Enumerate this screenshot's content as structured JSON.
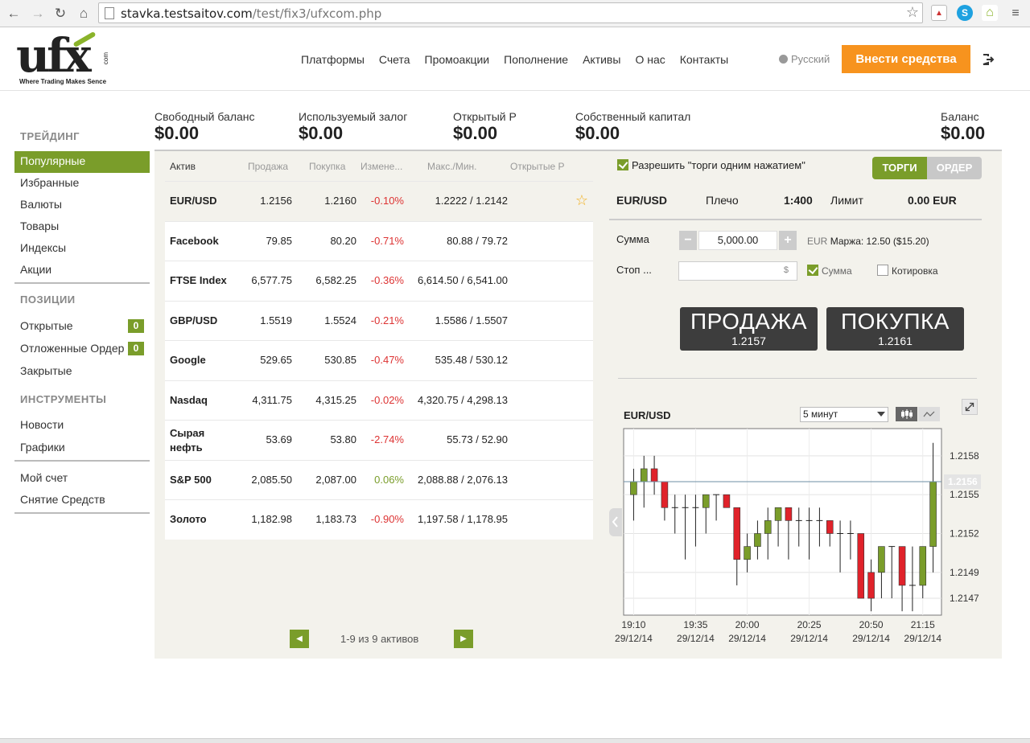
{
  "browser": {
    "url_host": "stavka.testsaitov.com",
    "url_path": "/test/fix3/ufxcom.php"
  },
  "logo": {
    "text": "ufx",
    "com": "com",
    "tagline": "Where Trading Makes Sence"
  },
  "nav": {
    "items": [
      "Платформы",
      "Счета",
      "Промоакции",
      "Пополнение",
      "Активы",
      "О нас",
      "Контакты"
    ],
    "language": "Русский",
    "deposit_button": "Внести средства"
  },
  "sidebar": {
    "trading_heading": "ТРЕЙДИНГ",
    "trading_items": [
      "Популярные",
      "Избранные",
      "Валюты",
      "Товары",
      "Индексы",
      "Акции"
    ],
    "positions_heading": "ПОЗИЦИИ",
    "positions_items": [
      {
        "label": "Открытые",
        "badge": "0"
      },
      {
        "label": "Отложенные Ордер",
        "badge": "0"
      },
      {
        "label": "Закрытые",
        "badge": ""
      }
    ],
    "tools_heading": "ИНСТРУМЕНТЫ",
    "tools_items": [
      "Новости",
      "Графики"
    ],
    "account_items": [
      "Мой счет",
      "Снятие Средств"
    ]
  },
  "balances": [
    {
      "label": "Свободный баланс",
      "value": "$0.00"
    },
    {
      "label": "Используемый залог",
      "value": "$0.00"
    },
    {
      "label": "Открытый P",
      "value": "$0.00"
    },
    {
      "label": "Собственный капитал",
      "value": "$0.00"
    },
    {
      "label": "Баланс",
      "value": "$0.00"
    }
  ],
  "table": {
    "headers": [
      "Актив",
      "Продажа",
      "Покупка",
      "Измене...",
      "Макс./Мин.",
      "Открытые Р"
    ],
    "rows": [
      {
        "name": "EUR/USD",
        "sell": "1.2156",
        "buy": "1.2160",
        "change": "-0.10%",
        "maxmin": "1.2222 / 1.2142",
        "dir": "neg"
      },
      {
        "name": "Facebook",
        "sell": "79.85",
        "buy": "80.20",
        "change": "-0.71%",
        "maxmin": "80.88 / 79.72",
        "dir": "neg"
      },
      {
        "name": "FTSE Index",
        "sell": "6,577.75",
        "buy": "6,582.25",
        "change": "-0.36%",
        "maxmin": "6,614.50 / 6,541.00",
        "dir": "neg"
      },
      {
        "name": "GBP/USD",
        "sell": "1.5519",
        "buy": "1.5524",
        "change": "-0.21%",
        "maxmin": "1.5586 / 1.5507",
        "dir": "neg"
      },
      {
        "name": "Google",
        "sell": "529.65",
        "buy": "530.85",
        "change": "-0.47%",
        "maxmin": "535.48 / 530.12",
        "dir": "neg"
      },
      {
        "name": "Nasdaq",
        "sell": "4,311.75",
        "buy": "4,315.25",
        "change": "-0.02%",
        "maxmin": "4,320.75 / 4,298.13",
        "dir": "neg"
      },
      {
        "name": "Сырая нефть",
        "sell": "53.69",
        "buy": "53.80",
        "change": "-2.74%",
        "maxmin": "55.73 / 52.90",
        "dir": "neg"
      },
      {
        "name": "S&P 500",
        "sell": "2,085.50",
        "buy": "2,087.00",
        "change": "0.06%",
        "maxmin": "2,088.88 / 2,076.13",
        "dir": "pos"
      },
      {
        "name": "Золото",
        "sell": "1,182.98",
        "buy": "1,183.73",
        "change": "-0.90%",
        "maxmin": "1,197.58 / 1,178.95",
        "dir": "neg"
      }
    ],
    "pager_text": "1-9 из  9 активов"
  },
  "trade": {
    "one_click_label": "Разрешить \"торги одним нажатием\"",
    "tab_trade": "ТОРГИ",
    "tab_order": "ОРДЕР",
    "symbol": "EUR/USD",
    "leverage_label": "Плечо",
    "leverage_value": "1:400",
    "limit_label": "Лимит",
    "limit_value": "0.00 EUR",
    "amount_label": "Сумма",
    "amount_value": "5,000.00",
    "currency": "EUR",
    "margin_text": "Маржа: 12.50 ($15.20)",
    "stop_label": "Стоп ...",
    "stop_placeholder": "$",
    "opt_amount": "Сумма",
    "opt_quote": "Котировка",
    "sell_label": "ПРОДАЖА",
    "sell_price": "1.2157",
    "buy_label": "ПОКУПКА",
    "buy_price": "1.2161"
  },
  "chart": {
    "title": "EUR/USD",
    "timeframe": "5 минут"
  },
  "chart_data": {
    "type": "candlestick",
    "title": "EUR/USD",
    "current_price": "1.2156",
    "y_ticks": [
      "1.2158",
      "1.2155",
      "1.2152",
      "1.2149",
      "1.2147"
    ],
    "y_tick_values": [
      1.2158,
      1.2155,
      1.2152,
      1.2149,
      1.2147
    ],
    "ylim": [
      1.21457,
      1.21601
    ],
    "x_ticks": [
      {
        "time": "19:10",
        "date": "29/12/14"
      },
      {
        "time": "19:35",
        "date": "29/12/14"
      },
      {
        "time": "20:00",
        "date": "29/12/14"
      },
      {
        "time": "20:25",
        "date": "29/12/14"
      },
      {
        "time": "20:50",
        "date": "29/12/14"
      },
      {
        "time": "21:15",
        "date": "29/12/14"
      }
    ],
    "colors": {
      "up": "#7a9d2a",
      "down": "#e0222a"
    },
    "candles": [
      {
        "o": 1.2155,
        "h": 1.2157,
        "l": 1.2153,
        "c": 1.2156
      },
      {
        "o": 1.2156,
        "h": 1.2158,
        "l": 1.2154,
        "c": 1.2157
      },
      {
        "o": 1.2157,
        "h": 1.2158,
        "l": 1.2155,
        "c": 1.2156
      },
      {
        "o": 1.2156,
        "h": 1.2156,
        "l": 1.2153,
        "c": 1.2154
      },
      {
        "o": 1.2154,
        "h": 1.2155,
        "l": 1.2152,
        "c": 1.2154
      },
      {
        "o": 1.2154,
        "h": 1.2155,
        "l": 1.215,
        "c": 1.2154
      },
      {
        "o": 1.2154,
        "h": 1.2155,
        "l": 1.2151,
        "c": 1.2154
      },
      {
        "o": 1.2154,
        "h": 1.2155,
        "l": 1.2152,
        "c": 1.2155
      },
      {
        "o": 1.2155,
        "h": 1.2155,
        "l": 1.2153,
        "c": 1.2155
      },
      {
        "o": 1.2155,
        "h": 1.2155,
        "l": 1.2154,
        "c": 1.2154
      },
      {
        "o": 1.2154,
        "h": 1.2154,
        "l": 1.2148,
        "c": 1.215
      },
      {
        "o": 1.215,
        "h": 1.2152,
        "l": 1.2149,
        "c": 1.2151
      },
      {
        "o": 1.2151,
        "h": 1.2153,
        "l": 1.215,
        "c": 1.2152
      },
      {
        "o": 1.2152,
        "h": 1.2154,
        "l": 1.215,
        "c": 1.2153
      },
      {
        "o": 1.2153,
        "h": 1.2154,
        "l": 1.2151,
        "c": 1.2154
      },
      {
        "o": 1.2154,
        "h": 1.2154,
        "l": 1.215,
        "c": 1.2153
      },
      {
        "o": 1.2153,
        "h": 1.2154,
        "l": 1.2151,
        "c": 1.2153
      },
      {
        "o": 1.2153,
        "h": 1.2154,
        "l": 1.215,
        "c": 1.2153
      },
      {
        "o": 1.2153,
        "h": 1.2154,
        "l": 1.2151,
        "c": 1.2153
      },
      {
        "o": 1.2153,
        "h": 1.2153,
        "l": 1.2151,
        "c": 1.2152
      },
      {
        "o": 1.2152,
        "h": 1.2153,
        "l": 1.2149,
        "c": 1.2152
      },
      {
        "o": 1.2152,
        "h": 1.2153,
        "l": 1.215,
        "c": 1.2152
      },
      {
        "o": 1.2152,
        "h": 1.2152,
        "l": 1.2148,
        "c": 1.2147
      },
      {
        "o": 1.2149,
        "h": 1.215,
        "l": 1.2146,
        "c": 1.2147
      },
      {
        "o": 1.2149,
        "h": 1.2151,
        "l": 1.2147,
        "c": 1.2151
      },
      {
        "o": 1.2151,
        "h": 1.2151,
        "l": 1.2147,
        "c": 1.2151
      },
      {
        "o": 1.2151,
        "h": 1.2151,
        "l": 1.2146,
        "c": 1.2148
      },
      {
        "o": 1.2148,
        "h": 1.2151,
        "l": 1.2146,
        "c": 1.2148
      },
      {
        "o": 1.2148,
        "h": 1.2151,
        "l": 1.2147,
        "c": 1.2151
      },
      {
        "o": 1.2151,
        "h": 1.2159,
        "l": 1.2149,
        "c": 1.2156
      }
    ]
  }
}
